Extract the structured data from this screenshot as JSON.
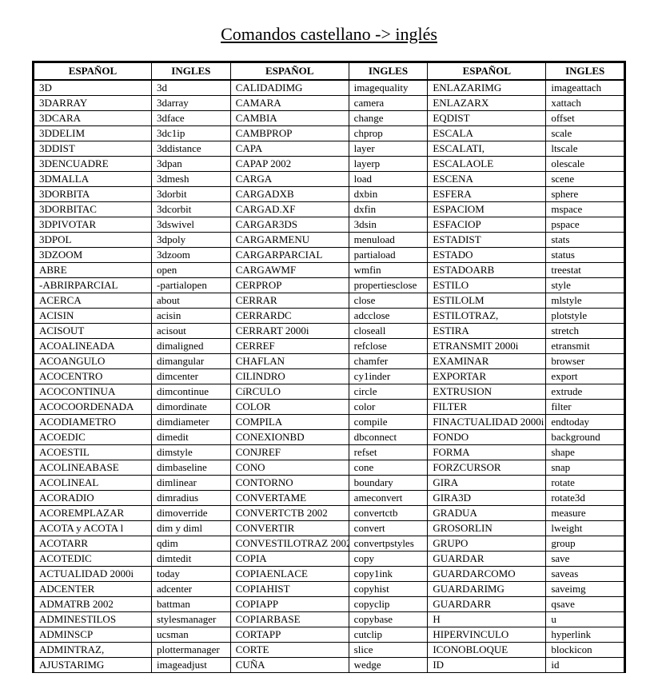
{
  "title": "Comandos castellano -> inglés",
  "headers": [
    "ESPAÑOL",
    "INGLES",
    "ESPAÑOL",
    "INGLES",
    "ESPAÑOL",
    "INGLES"
  ],
  "rows": [
    [
      "3D",
      "3d",
      "CALIDADIMG",
      "imagequality",
      "ENLAZARIMG",
      "imageattach"
    ],
    [
      "3DARRAY",
      "3darray",
      "CAMARA",
      "camera",
      "ENLAZARX",
      "xattach"
    ],
    [
      "3DCARA",
      "3dface",
      "CAMBIA",
      "change",
      "EQDIST",
      "offset"
    ],
    [
      "3DDELIM",
      "3dc1ip",
      "CAMBPROP",
      "chprop",
      "ESCALA",
      "scale"
    ],
    [
      "3DDIST",
      "3ddistance",
      "CAPA",
      "layer",
      "ESCALATI,",
      "ltscale"
    ],
    [
      "3DENCUADRE",
      "3dpan",
      "CAPAP 2002",
      "layerp",
      "ESCALAOLE",
      "olescale"
    ],
    [
      "3DMALLA",
      "3dmesh",
      "CARGA",
      "load",
      "ESCENA",
      "scene"
    ],
    [
      "3DORBITA",
      "3dorbit",
      "CARGADXB",
      "dxbin",
      "ESFERA",
      "sphere"
    ],
    [
      "3DORBITAC",
      "3dcorbit",
      "CARGAD.XF",
      "dxfin",
      "ESPACIOM",
      "mspace"
    ],
    [
      "3DPIVOTAR",
      "3dswivel",
      "CARGAR3DS",
      "3dsin",
      "ESFACIOP",
      "pspace"
    ],
    [
      "3DPOL",
      "3dpoly",
      "CARGARMENU",
      "menuload",
      "ESTADIST",
      "stats"
    ],
    [
      "3DZOOM",
      "3dzoom",
      "CARGARPARCIAL",
      "partiaload",
      "ESTADO",
      "status"
    ],
    [
      "ABRE",
      "open",
      "CARGAWMF",
      "wmfin",
      "ESTADOARB",
      "treestat"
    ],
    [
      "-ABRIRPARCIAL",
      "-partialopen",
      "CERPROP",
      "propertiesclose",
      "ESTILO",
      "style"
    ],
    [
      "ACERCA",
      "about",
      "CERRAR",
      "close",
      "ESTILOLM",
      "mlstyle"
    ],
    [
      "ACISIN",
      "acisin",
      "CERRARDC",
      "adcclose",
      "ESTILOTRAZ,",
      "plotstyle"
    ],
    [
      "ACISOUT",
      "acisout",
      "CERRART 2000i",
      "closeall",
      "ESTIRA",
      "stretch"
    ],
    [
      "ACOALINEADA",
      "dimaligned",
      "CERREF",
      "refclose",
      "ETRANSMIT 2000i",
      "etransmit"
    ],
    [
      "ACOANGULO",
      "dimangular",
      "CHAFLAN",
      "chamfer",
      "EXAMINAR",
      "browser"
    ],
    [
      "ACOCENTRO",
      "dimcenter",
      "CILINDRO",
      "cy1inder",
      "EXPORTAR",
      "export"
    ],
    [
      "ACOCONTINUA",
      "dimcontinue",
      "CíRCULO",
      "circle",
      "EXTRUSION",
      "extrude"
    ],
    [
      "ACOCOORDENADA",
      "dimordinate",
      "COLOR",
      "color",
      "FILTER",
      "filter"
    ],
    [
      "ACODIAMETRO",
      "dimdiameter",
      "COMPILA",
      "compile",
      "FINACTUALIDAD 2000i",
      "endtoday"
    ],
    [
      "ACOEDIC",
      "dimedit",
      "CONEXIONBD",
      "dbconnect",
      "FONDO",
      "background"
    ],
    [
      "ACOESTIL",
      "dimstyle",
      "CONJREF",
      "refset",
      "FORMA",
      "shape"
    ],
    [
      "ACOLINEABASE",
      "dimbaseline",
      "CONO",
      "cone",
      "FORZCURSOR",
      "snap"
    ],
    [
      "ACOLINEAL",
      "dimlinear",
      "CONTORNO",
      "boundary",
      "GIRA",
      "rotate"
    ],
    [
      "ACORADIO",
      "dimradius",
      "CONVERTAME",
      "ameconvert",
      "GIRA3D",
      "rotate3d"
    ],
    [
      "ACOREMPLAZAR",
      "dimoverride",
      "CONVERTCTB 2002",
      "convertctb",
      "GRADUA",
      "measure"
    ],
    [
      "ACOTA y ACOTA l",
      "dim y diml",
      "CONVERTIR",
      "convert",
      "GROSORLIN",
      "lweight"
    ],
    [
      "ACOTARR",
      "qdim",
      "CONVESTILOTRAZ 2002",
      "convertpstyles",
      "GRUPO",
      "group"
    ],
    [
      "ACOTEDIC",
      "dimtedit",
      "COPIA",
      "copy",
      "GUARDAR",
      "save"
    ],
    [
      "ACTUALIDAD 2000i",
      "today",
      "COPIAENLACE",
      "copy1ink",
      "GUARDARCOMO",
      "saveas"
    ],
    [
      "ADCENTER",
      "adcenter",
      "COPIAHIST",
      "copyhist",
      "GUARDARIMG",
      "saveimg"
    ],
    [
      "ADMATRB 2002",
      "battman",
      "COPIAPP",
      "copyclip",
      "GUARDARR",
      "qsave"
    ],
    [
      "ADMINESTILOS",
      "stylesmanager",
      "COPIARBASE",
      "copybase",
      "H",
      "u"
    ],
    [
      "ADMINSCP",
      "ucsman",
      "CORTAPP",
      "cutclip",
      "HIPERVINCULO",
      "hyperlink"
    ],
    [
      "ADMINTRAZ,",
      "plottermanager",
      "CORTE",
      "slice",
      "ICONOBLOQUE",
      "blockicon"
    ],
    [
      "AJUSTARIMG",
      "imageadjust",
      "CUÑA",
      "wedge",
      "ID",
      "id"
    ]
  ]
}
